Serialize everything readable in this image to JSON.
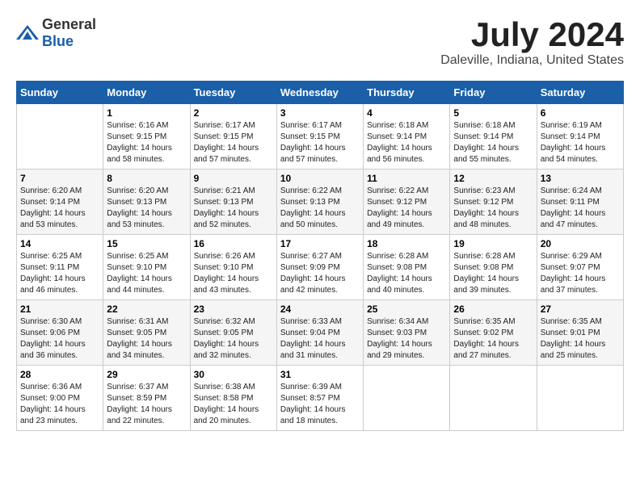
{
  "header": {
    "logo_general": "General",
    "logo_blue": "Blue",
    "main_title": "July 2024",
    "subtitle": "Daleville, Indiana, United States"
  },
  "calendar": {
    "days_of_week": [
      "Sunday",
      "Monday",
      "Tuesday",
      "Wednesday",
      "Thursday",
      "Friday",
      "Saturday"
    ],
    "weeks": [
      [
        {
          "day": "",
          "sunrise": "",
          "sunset": "",
          "daylight": ""
        },
        {
          "day": "1",
          "sunrise": "6:16 AM",
          "sunset": "9:15 PM",
          "daylight": "14 hours and 58 minutes."
        },
        {
          "day": "2",
          "sunrise": "6:17 AM",
          "sunset": "9:15 PM",
          "daylight": "14 hours and 57 minutes."
        },
        {
          "day": "3",
          "sunrise": "6:17 AM",
          "sunset": "9:15 PM",
          "daylight": "14 hours and 57 minutes."
        },
        {
          "day": "4",
          "sunrise": "6:18 AM",
          "sunset": "9:14 PM",
          "daylight": "14 hours and 56 minutes."
        },
        {
          "day": "5",
          "sunrise": "6:18 AM",
          "sunset": "9:14 PM",
          "daylight": "14 hours and 55 minutes."
        },
        {
          "day": "6",
          "sunrise": "6:19 AM",
          "sunset": "9:14 PM",
          "daylight": "14 hours and 54 minutes."
        }
      ],
      [
        {
          "day": "7",
          "sunrise": "6:20 AM",
          "sunset": "9:14 PM",
          "daylight": "14 hours and 53 minutes."
        },
        {
          "day": "8",
          "sunrise": "6:20 AM",
          "sunset": "9:13 PM",
          "daylight": "14 hours and 53 minutes."
        },
        {
          "day": "9",
          "sunrise": "6:21 AM",
          "sunset": "9:13 PM",
          "daylight": "14 hours and 52 minutes."
        },
        {
          "day": "10",
          "sunrise": "6:22 AM",
          "sunset": "9:13 PM",
          "daylight": "14 hours and 50 minutes."
        },
        {
          "day": "11",
          "sunrise": "6:22 AM",
          "sunset": "9:12 PM",
          "daylight": "14 hours and 49 minutes."
        },
        {
          "day": "12",
          "sunrise": "6:23 AM",
          "sunset": "9:12 PM",
          "daylight": "14 hours and 48 minutes."
        },
        {
          "day": "13",
          "sunrise": "6:24 AM",
          "sunset": "9:11 PM",
          "daylight": "14 hours and 47 minutes."
        }
      ],
      [
        {
          "day": "14",
          "sunrise": "6:25 AM",
          "sunset": "9:11 PM",
          "daylight": "14 hours and 46 minutes."
        },
        {
          "day": "15",
          "sunrise": "6:25 AM",
          "sunset": "9:10 PM",
          "daylight": "14 hours and 44 minutes."
        },
        {
          "day": "16",
          "sunrise": "6:26 AM",
          "sunset": "9:10 PM",
          "daylight": "14 hours and 43 minutes."
        },
        {
          "day": "17",
          "sunrise": "6:27 AM",
          "sunset": "9:09 PM",
          "daylight": "14 hours and 42 minutes."
        },
        {
          "day": "18",
          "sunrise": "6:28 AM",
          "sunset": "9:08 PM",
          "daylight": "14 hours and 40 minutes."
        },
        {
          "day": "19",
          "sunrise": "6:28 AM",
          "sunset": "9:08 PM",
          "daylight": "14 hours and 39 minutes."
        },
        {
          "day": "20",
          "sunrise": "6:29 AM",
          "sunset": "9:07 PM",
          "daylight": "14 hours and 37 minutes."
        }
      ],
      [
        {
          "day": "21",
          "sunrise": "6:30 AM",
          "sunset": "9:06 PM",
          "daylight": "14 hours and 36 minutes."
        },
        {
          "day": "22",
          "sunrise": "6:31 AM",
          "sunset": "9:05 PM",
          "daylight": "14 hours and 34 minutes."
        },
        {
          "day": "23",
          "sunrise": "6:32 AM",
          "sunset": "9:05 PM",
          "daylight": "14 hours and 32 minutes."
        },
        {
          "day": "24",
          "sunrise": "6:33 AM",
          "sunset": "9:04 PM",
          "daylight": "14 hours and 31 minutes."
        },
        {
          "day": "25",
          "sunrise": "6:34 AM",
          "sunset": "9:03 PM",
          "daylight": "14 hours and 29 minutes."
        },
        {
          "day": "26",
          "sunrise": "6:35 AM",
          "sunset": "9:02 PM",
          "daylight": "14 hours and 27 minutes."
        },
        {
          "day": "27",
          "sunrise": "6:35 AM",
          "sunset": "9:01 PM",
          "daylight": "14 hours and 25 minutes."
        }
      ],
      [
        {
          "day": "28",
          "sunrise": "6:36 AM",
          "sunset": "9:00 PM",
          "daylight": "14 hours and 23 minutes."
        },
        {
          "day": "29",
          "sunrise": "6:37 AM",
          "sunset": "8:59 PM",
          "daylight": "14 hours and 22 minutes."
        },
        {
          "day": "30",
          "sunrise": "6:38 AM",
          "sunset": "8:58 PM",
          "daylight": "14 hours and 20 minutes."
        },
        {
          "day": "31",
          "sunrise": "6:39 AM",
          "sunset": "8:57 PM",
          "daylight": "14 hours and 18 minutes."
        },
        {
          "day": "",
          "sunrise": "",
          "sunset": "",
          "daylight": ""
        },
        {
          "day": "",
          "sunrise": "",
          "sunset": "",
          "daylight": ""
        },
        {
          "day": "",
          "sunrise": "",
          "sunset": "",
          "daylight": ""
        }
      ]
    ]
  }
}
